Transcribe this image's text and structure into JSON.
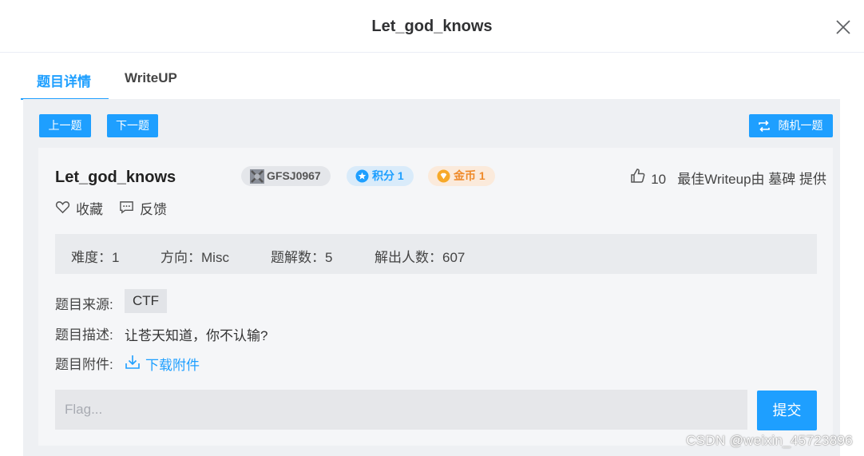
{
  "modal": {
    "title": "Let_god_knows"
  },
  "tabs": [
    {
      "label": "题目详情"
    },
    {
      "label": "WriteUP"
    }
  ],
  "nav": {
    "prev": "上一题",
    "next": "下一题",
    "random": "随机一题"
  },
  "problem": {
    "title": "Let_god_knows",
    "badges": {
      "id": "GFSJ0967",
      "score": "积分 1",
      "coin": "金币 1"
    },
    "likes_count": "10",
    "best_writeup": "最佳Writeup由 墓碑 提供",
    "actions": {
      "favorite": "收藏",
      "feedback": "反馈"
    },
    "stats": {
      "difficulty": "难度：1",
      "direction": "方向：Misc",
      "solutions": "题解数：5",
      "solvers": "解出人数：607"
    },
    "source_label": "题目来源:",
    "source_value": "CTF",
    "desc_label": "题目描述:",
    "desc_value": "让苍天知道，你不认输?",
    "attach_label": "题目附件:",
    "attach_link": "下载附件"
  },
  "flag": {
    "placeholder": "Flag...",
    "value": "",
    "submit": "提交"
  },
  "watermark": "CSDN @weixin_45723896",
  "colors": {
    "accent": "#1e9fff",
    "coin": "#ef8a2a",
    "panel": "#eef0f3"
  },
  "icons": [
    "close-icon",
    "swap-icon",
    "avatar-icon",
    "score-icon",
    "coin-icon",
    "thumbs-up-icon",
    "heart-icon",
    "message-icon",
    "download-icon"
  ]
}
